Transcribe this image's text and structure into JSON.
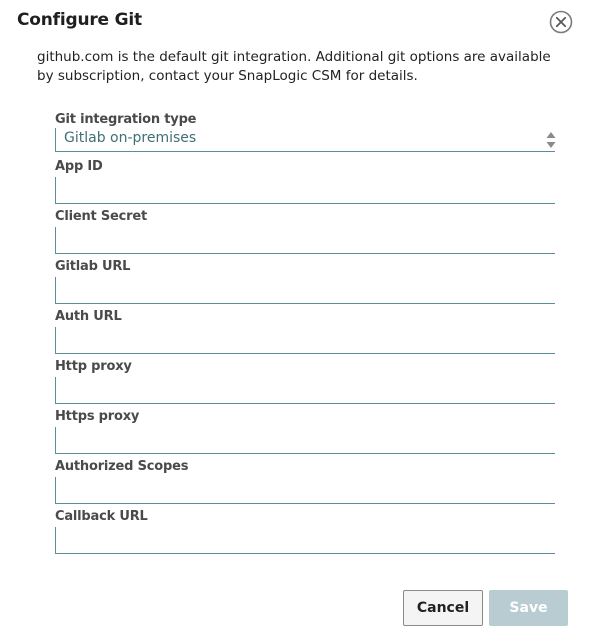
{
  "dialog": {
    "title": "Configure Git",
    "intro": "github.com is the default git integration. Additional git options are available by subscription, contact your SnapLogic CSM for details."
  },
  "integration_type": {
    "label": "Git integration type",
    "value": "Gitlab on-premises"
  },
  "fields": {
    "app_id": {
      "label": "App ID",
      "value": ""
    },
    "client_secret": {
      "label": "Client Secret",
      "value": ""
    },
    "gitlab_url": {
      "label": "Gitlab URL",
      "value": ""
    },
    "auth_url": {
      "label": "Auth URL",
      "value": ""
    },
    "http_proxy": {
      "label": "Http proxy",
      "value": ""
    },
    "https_proxy": {
      "label": "Https proxy",
      "value": ""
    },
    "authorized_scopes": {
      "label": "Authorized Scopes",
      "value": ""
    },
    "callback_url": {
      "label": "Callback URL",
      "value": ""
    }
  },
  "actions": {
    "cancel_label": "Cancel",
    "save_label": "Save"
  },
  "icons": {
    "close": "close-circle-icon",
    "select_arrows": "up-down-arrows-icon"
  },
  "colors": {
    "field_border": "#5a8f96",
    "select_text": "#3f6f77",
    "save_disabled_bg": "#b8ccd2"
  }
}
